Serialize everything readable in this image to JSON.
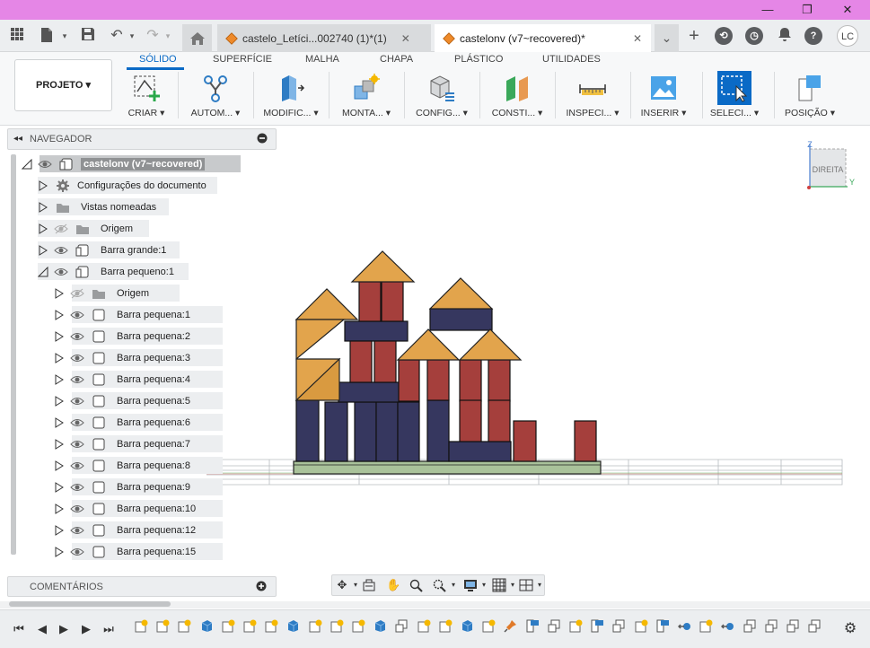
{
  "window": {
    "minimize_label": "—",
    "restore_label": "❐",
    "close_label": "✕"
  },
  "tabs": [
    {
      "label": "castelo_Letíci...002740 (1)*(1)",
      "active": false
    },
    {
      "label": "castelonv (v7~recovered)*",
      "active": true
    }
  ],
  "user": {
    "initials": "LC"
  },
  "ribbon": {
    "workspace": "PROJETO ▾",
    "tabs": [
      "SÓLIDO",
      "SUPERFÍCIE",
      "MALHA",
      "CHAPA",
      "PLÁSTICO",
      "UTILIDADES"
    ],
    "active_tab": "SÓLIDO",
    "groups": [
      "CRIAR ▾",
      "AUTOM... ▾",
      "MODIFIC... ▾",
      "MONTA... ▾",
      "CONFIG... ▾",
      "CONSTI... ▾",
      "INSPECI... ▾",
      "INSERIR ▾",
      "SELECI... ▾",
      "POSIÇÃO ▾"
    ]
  },
  "navigator": {
    "title": "NAVEGADOR",
    "root": "castelonv (v7~recovered)",
    "items": [
      {
        "label": "Configurações do documento",
        "icon": "gear-icon"
      },
      {
        "label": "Vistas nomeadas",
        "icon": "folder-icon"
      },
      {
        "label": "Origem",
        "icon": "folder-icon"
      },
      {
        "label": "Barra grande:1",
        "icon": "component-icon"
      },
      {
        "label": "Barra pequeno:1",
        "icon": "component-icon"
      }
    ],
    "children": [
      {
        "label": "Origem"
      },
      {
        "label": "Barra pequena:1"
      },
      {
        "label": "Barra pequena:2"
      },
      {
        "label": "Barra pequena:3"
      },
      {
        "label": "Barra pequena:4"
      },
      {
        "label": "Barra pequena:5"
      },
      {
        "label": "Barra pequena:6"
      },
      {
        "label": "Barra pequena:7"
      },
      {
        "label": "Barra pequena:8"
      },
      {
        "label": "Barra pequena:9"
      },
      {
        "label": "Barra pequena:10"
      },
      {
        "label": "Barra pequena:12"
      },
      {
        "label": "Barra pequena:15"
      }
    ]
  },
  "comments": {
    "title": "COMENTÁRIOS"
  },
  "viewcube": {
    "face": "DIREITA",
    "axis_z": "Z",
    "axis_y": "Y"
  },
  "colors": {
    "accent": "#0a6ac6",
    "titlebar": "#e586e6",
    "block_blue": "#36375f",
    "block_red": "#a53f3c",
    "roof": "#e2a44c",
    "base": "#a9c29a"
  }
}
